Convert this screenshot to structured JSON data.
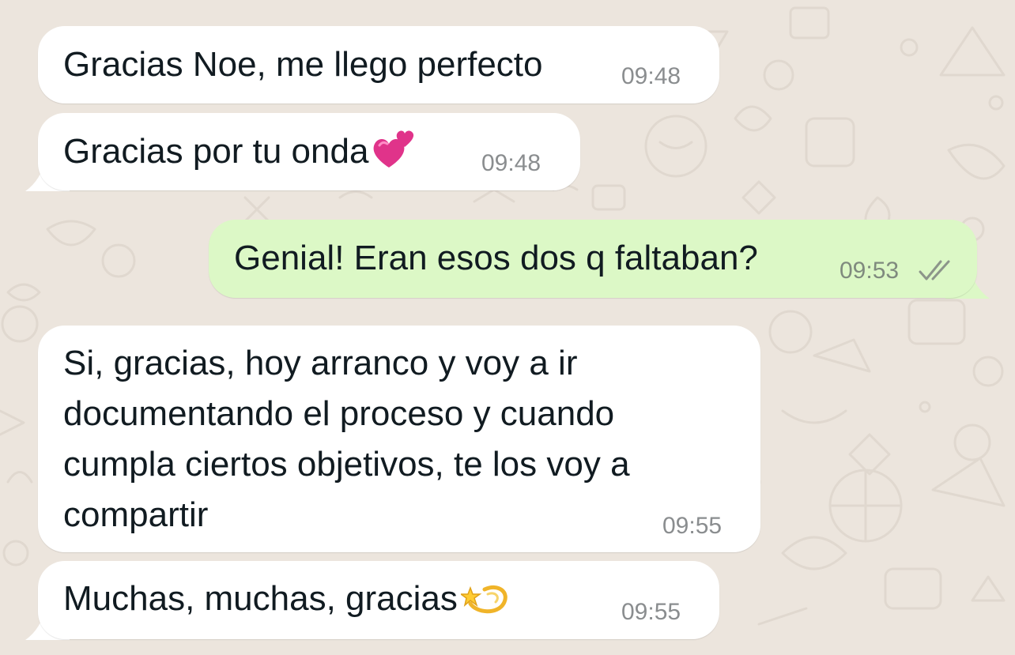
{
  "theme": {
    "background": "#ece5dd",
    "incoming_bubble": "#ffffff",
    "outgoing_bubble": "#dcf8c6",
    "timestamp_color": "#8a8d8f",
    "text_color": "#111b21"
  },
  "messages": [
    {
      "direction": "incoming",
      "text": "Gracias Noe, me llego perfecto",
      "time": "09:48"
    },
    {
      "direction": "incoming",
      "text": "Gracias por tu onda",
      "emoji": "two-hearts-icon",
      "time": "09:48"
    },
    {
      "direction": "outgoing",
      "text": "Genial! Eran esos dos q faltaban?",
      "time": "09:53",
      "status": "delivered-double-check-icon"
    },
    {
      "direction": "incoming",
      "text": "Si, gracias, hoy arranco y voy a ir documentando el proceso y cuando cumpla ciertos objetivos, te los voy a compartir",
      "time": "09:55"
    },
    {
      "direction": "incoming",
      "text": "Muchas, muchas, gracias",
      "emoji": "dizzy-star-icon",
      "time": "09:55"
    }
  ]
}
